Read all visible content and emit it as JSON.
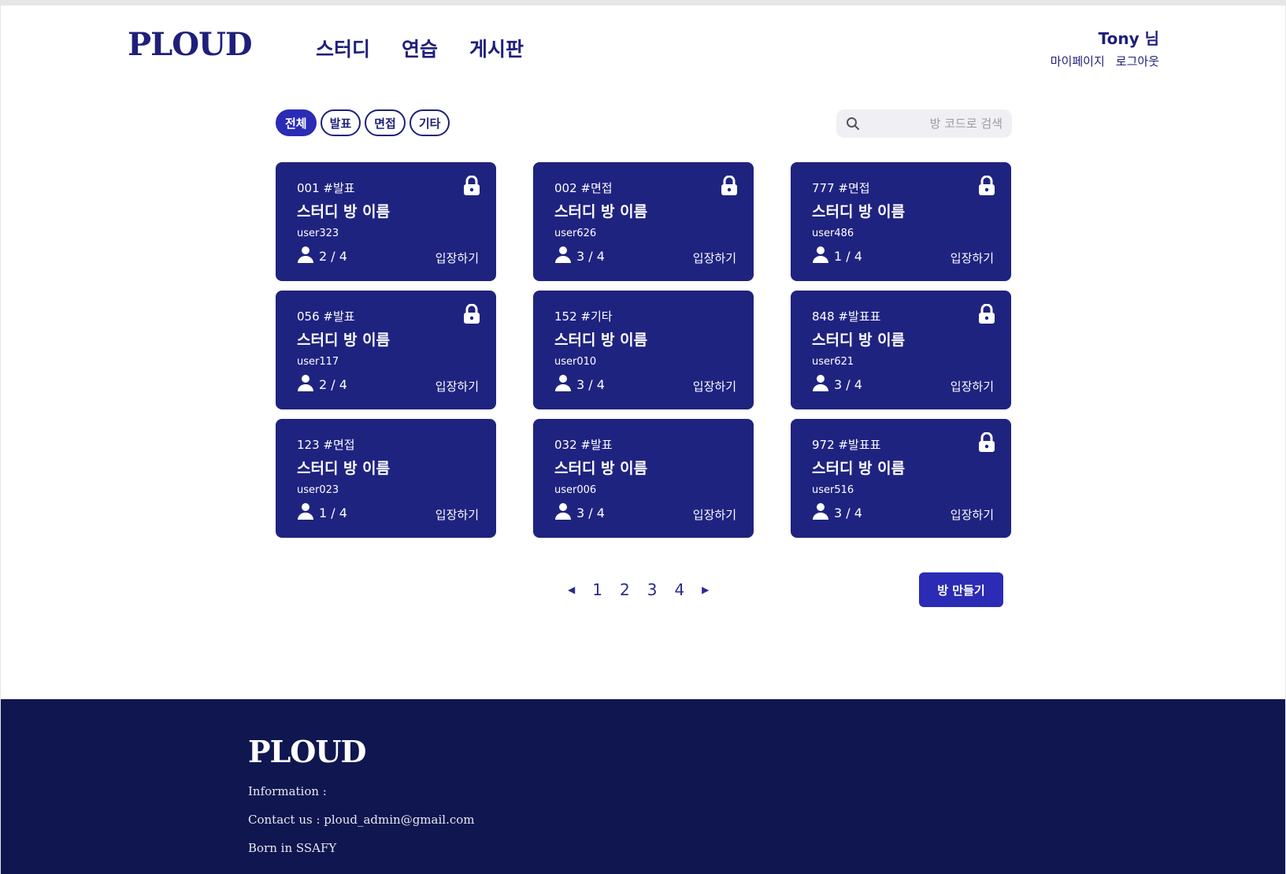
{
  "header": {
    "logo": "PLOUD",
    "nav": [
      "스터디",
      "연습",
      "게시판"
    ],
    "user_name": "Tony 님",
    "mypage": "마이페이지",
    "logout": "로그아웃"
  },
  "filters": [
    "전체",
    "발표",
    "면접",
    "기타"
  ],
  "active_filter": "전체",
  "search": {
    "placeholder": "방 코드로 검색",
    "icon": "search-icon"
  },
  "rooms": [
    {
      "meta": "001  #발표",
      "title": "스터디 방 이름",
      "owner": "user323",
      "members": "2 / 4",
      "enter": "입장하기",
      "locked": true
    },
    {
      "meta": "002 #면접",
      "title": "스터디 방 이름",
      "owner": "user626",
      "members": "3 / 4",
      "enter": "입장하기",
      "locked": true
    },
    {
      "meta": "777 #면접",
      "title": "스터디 방 이름",
      "owner": "user486",
      "members": "1 / 4",
      "enter": "입장하기",
      "locked": true
    },
    {
      "meta": "056  #발표",
      "title": "스터디 방 이름",
      "owner": "user117",
      "members": "2 / 4",
      "enter": "입장하기",
      "locked": true
    },
    {
      "meta": "152  #기타",
      "title": "스터디 방 이름",
      "owner": "user010",
      "members": "3 / 4",
      "enter": "입장하기",
      "locked": false
    },
    {
      "meta": "848 #발표표",
      "title": "스터디 방 이름",
      "owner": "user621",
      "members": "3 / 4",
      "enter": "입장하기",
      "locked": true
    },
    {
      "meta": "123  #면접",
      "title": "스터디 방 이름",
      "owner": "user023",
      "members": "1 / 4",
      "enter": "입장하기",
      "locked": false
    },
    {
      "meta": "032  #발표",
      "title": "스터디 방 이름",
      "owner": "user006",
      "members": "3 / 4",
      "enter": "입장하기",
      "locked": false
    },
    {
      "meta": "972  #발표표",
      "title": "스터디 방 이름",
      "owner": "user516",
      "members": "3 / 4",
      "enter": "입장하기",
      "locked": true
    }
  ],
  "pagination": {
    "pages": [
      "1",
      "2",
      "3",
      "4"
    ],
    "prev": "◀",
    "next": "▶"
  },
  "create_button": "방 만들기",
  "footer": {
    "logo": "PLOUD",
    "information": "Information :",
    "contact": "Contact us : ploud_admin@gmail.com",
    "born": "Born in SSAFY"
  },
  "colors": {
    "primary": "#1f2380",
    "accent": "#2b2bb5",
    "footer_bg": "#10164f"
  }
}
